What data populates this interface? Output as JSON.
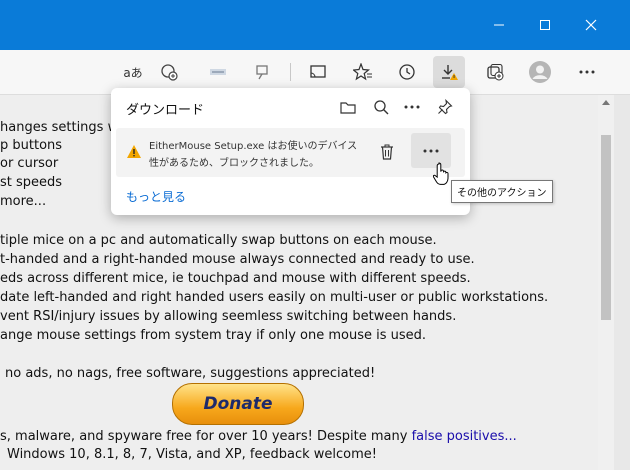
{
  "window_controls": {
    "minimize": "—",
    "maximize": "☐",
    "close": "✕"
  },
  "toolbar": {
    "read_aloud_text": "aあ"
  },
  "downloads": {
    "title": "ダウンロード",
    "item": {
      "line1": "EitherMouse Setup.exe はお使いのデバイス",
      "line2": "性があるため、ブロックされました。"
    },
    "more_actions": "…",
    "see_more": "もっと見る",
    "tooltip": "その他のアクション"
  },
  "page": {
    "lines": [
      "hanges settings w",
      "p buttons",
      "or cursor",
      "st speeds",
      "more...",
      "tiple mice on a pc and automatically swap buttons on each mouse.",
      "t-handed and a right-handed mouse always connected and ready to use.",
      "eds across different mice, ie touchpad and mouse with different speeds.",
      "date left-handed and right handed users easily on multi-user or public workstations.",
      "vent RSI/injury issues by allowing seemless switching between hands.",
      "ange mouse settings from system tray if only one mouse is used.",
      "no ads, no nags, free software, suggestions appreciated!"
    ],
    "donate_label": "Donate",
    "line_malware": "s, malware, and spyware free for over 10 years! Despite many ",
    "false_positives": "false positives...",
    "line_windows": "Windows 10, 8.1, 8, 7, Vista, and XP, feedback welcome!"
  },
  "colors": {
    "titlebar": "#0a7bd8",
    "link": "#1a0dab",
    "warning": "#f2a600"
  }
}
